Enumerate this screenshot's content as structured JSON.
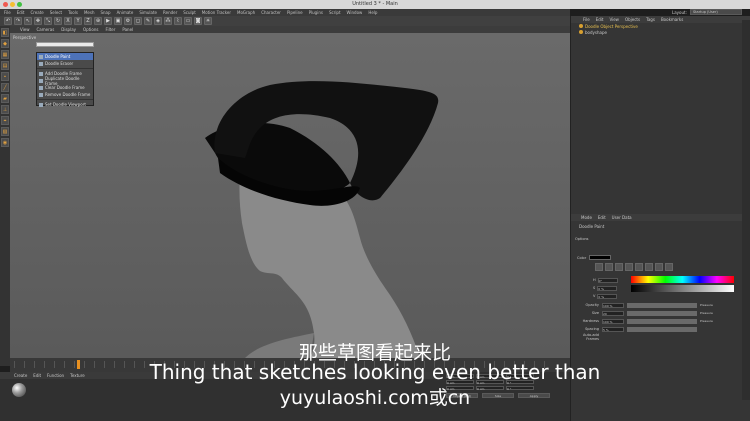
{
  "window": {
    "title": "Untitled 3 * - Main"
  },
  "menubar": [
    "File",
    "Edit",
    "Create",
    "Select",
    "Tools",
    "Mesh",
    "Snap",
    "Animate",
    "Simulate",
    "Render",
    "Sculpt",
    "Motion Tracker",
    "MoGraph",
    "Character",
    "Pipeline",
    "Plugins",
    "Script",
    "Window",
    "Help"
  ],
  "layout": {
    "label": "Layout:",
    "value": "Startup (User)"
  },
  "viewport": {
    "menu": [
      "View",
      "Cameras",
      "Display",
      "Options",
      "Filter",
      "Panel"
    ],
    "label": "Perspective"
  },
  "context_menu": {
    "items": [
      {
        "label": "Doodle Paint",
        "active": true
      },
      {
        "label": "Doodle Eraser",
        "active": false
      },
      {
        "label": "Add Doodle Frame",
        "active": false
      },
      {
        "label": "Duplicate Doodle Frame",
        "active": false
      },
      {
        "label": "Clear Doodle Frame",
        "active": false
      },
      {
        "label": "Remove Doodle Frame",
        "active": false
      },
      {
        "label": "Set Doodle Viewport",
        "active": false
      }
    ]
  },
  "object_manager": {
    "menu": [
      "File",
      "Edit",
      "View",
      "Objects",
      "Tags",
      "Bookmarks"
    ],
    "objects": [
      {
        "label": "Doodle Object Perspective",
        "selected": true
      },
      {
        "label": "bodyshape",
        "selected": false
      }
    ]
  },
  "attribute_manager": {
    "menu": [
      "Mode",
      "Edit",
      "User Data"
    ],
    "header": "Doodle Paint",
    "sub": "Options",
    "color_label": "Color",
    "values": [
      {
        "label": "H",
        "value": "0°"
      },
      {
        "label": "S",
        "value": "0 %"
      },
      {
        "label": "V",
        "value": "0 %"
      }
    ],
    "sliders": [
      {
        "label": "Opacity",
        "value": "100 %",
        "tag": "Pressure"
      },
      {
        "label": "Size",
        "value": "20",
        "tag": "Pressure"
      },
      {
        "label": "Hardness",
        "value": "100 %",
        "tag": "Pressure"
      },
      {
        "label": "Spacing",
        "value": "5 %",
        "tag": ""
      }
    ],
    "auto_add": "Auto-add Frames"
  },
  "materials": {
    "menu": [
      "Create",
      "Edit",
      "Function",
      "Texture"
    ]
  },
  "coordinates": {
    "fields": [
      [
        "0 cm",
        "0 cm",
        "0 °"
      ],
      [
        "0 cm",
        "0 cm",
        "0 °"
      ],
      [
        "0 cm",
        "0 cm",
        "0 °"
      ]
    ],
    "buttons": [
      "Object (Rel)",
      "Size",
      "Apply"
    ]
  },
  "subtitles": {
    "zh": "那些草图看起来比",
    "en": "Thing that sketches looking even better than",
    "url": "yuyulaoshi.com或cn"
  },
  "colors": {
    "accent": "#4d72b8",
    "viewport": "#646464",
    "timeline_marker": "#e89020"
  }
}
